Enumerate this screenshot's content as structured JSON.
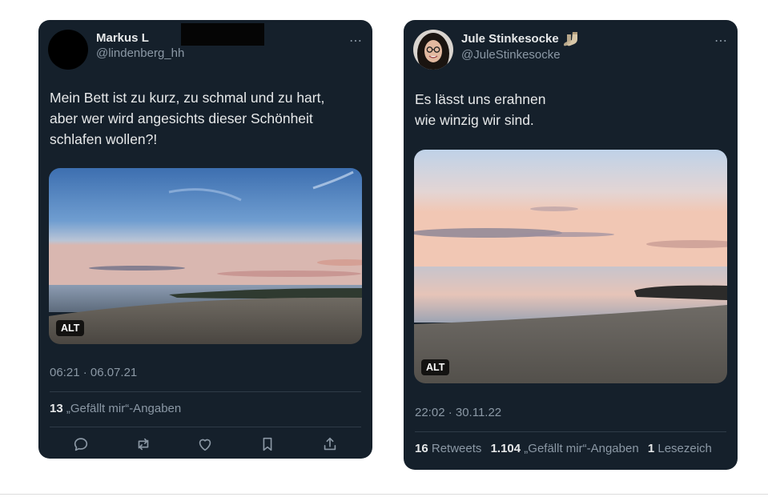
{
  "tweets": [
    {
      "display_name": "Markus Lindenberg",
      "display_name_visible": "Markus L",
      "handle": "@lindenberg_hh",
      "more_icon": "⋯",
      "text_lines": [
        "Mein Bett ist zu kurz, zu schmal und zu hart,",
        "aber wer wird angesichts dieser Schönheit",
        "schlafen wollen?!"
      ],
      "media_alt_badge": "ALT",
      "timestamp": "06:21 · 06.07.21",
      "likes_count": "13",
      "likes_label": "„Gefällt mir“-Angaben",
      "actions": [
        "reply-icon",
        "retweet-icon",
        "like-icon",
        "bookmark-icon",
        "share-icon"
      ]
    },
    {
      "display_name": "Jule Stinkesocke",
      "name_emoji": "socks-emoji",
      "handle": "@JuleStinkesocke",
      "more_icon": "⋯",
      "text_lines": [
        "Es lässt uns erahnen",
        "wie winzig wir sind."
      ],
      "media_alt_badge": "ALT",
      "timestamp": "22:02 · 30.11.22",
      "retweets_count": "16",
      "retweets_label": "Retweets",
      "likes_count": "1.104",
      "likes_label": "„Gefällt mir“-Angaben",
      "bookmarks_count": "1",
      "bookmarks_label": "Lesezeich"
    }
  ],
  "colors": {
    "card_bg": "#15202b",
    "text_primary": "#e7e9ea",
    "text_secondary": "#8b98a5",
    "divider": "#2f3b47"
  }
}
